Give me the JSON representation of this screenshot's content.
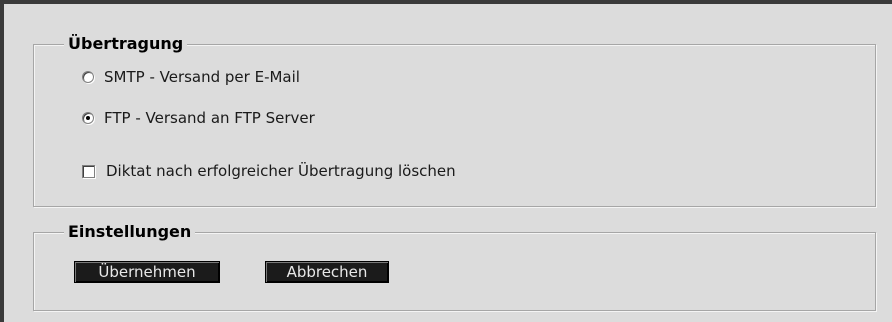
{
  "transfer": {
    "legend": "Übertragung",
    "options": [
      {
        "label": "SMTP - Versand per E-Mail",
        "selected": false
      },
      {
        "label": "FTP - Versand an FTP Server",
        "selected": true
      }
    ],
    "delete_after_transfer": {
      "label": "Diktat nach erfolgreicher Übertragung löschen",
      "checked": false
    }
  },
  "settings": {
    "legend": "Einstellungen",
    "apply_label": "Übernehmen",
    "cancel_label": "Abbrechen"
  }
}
